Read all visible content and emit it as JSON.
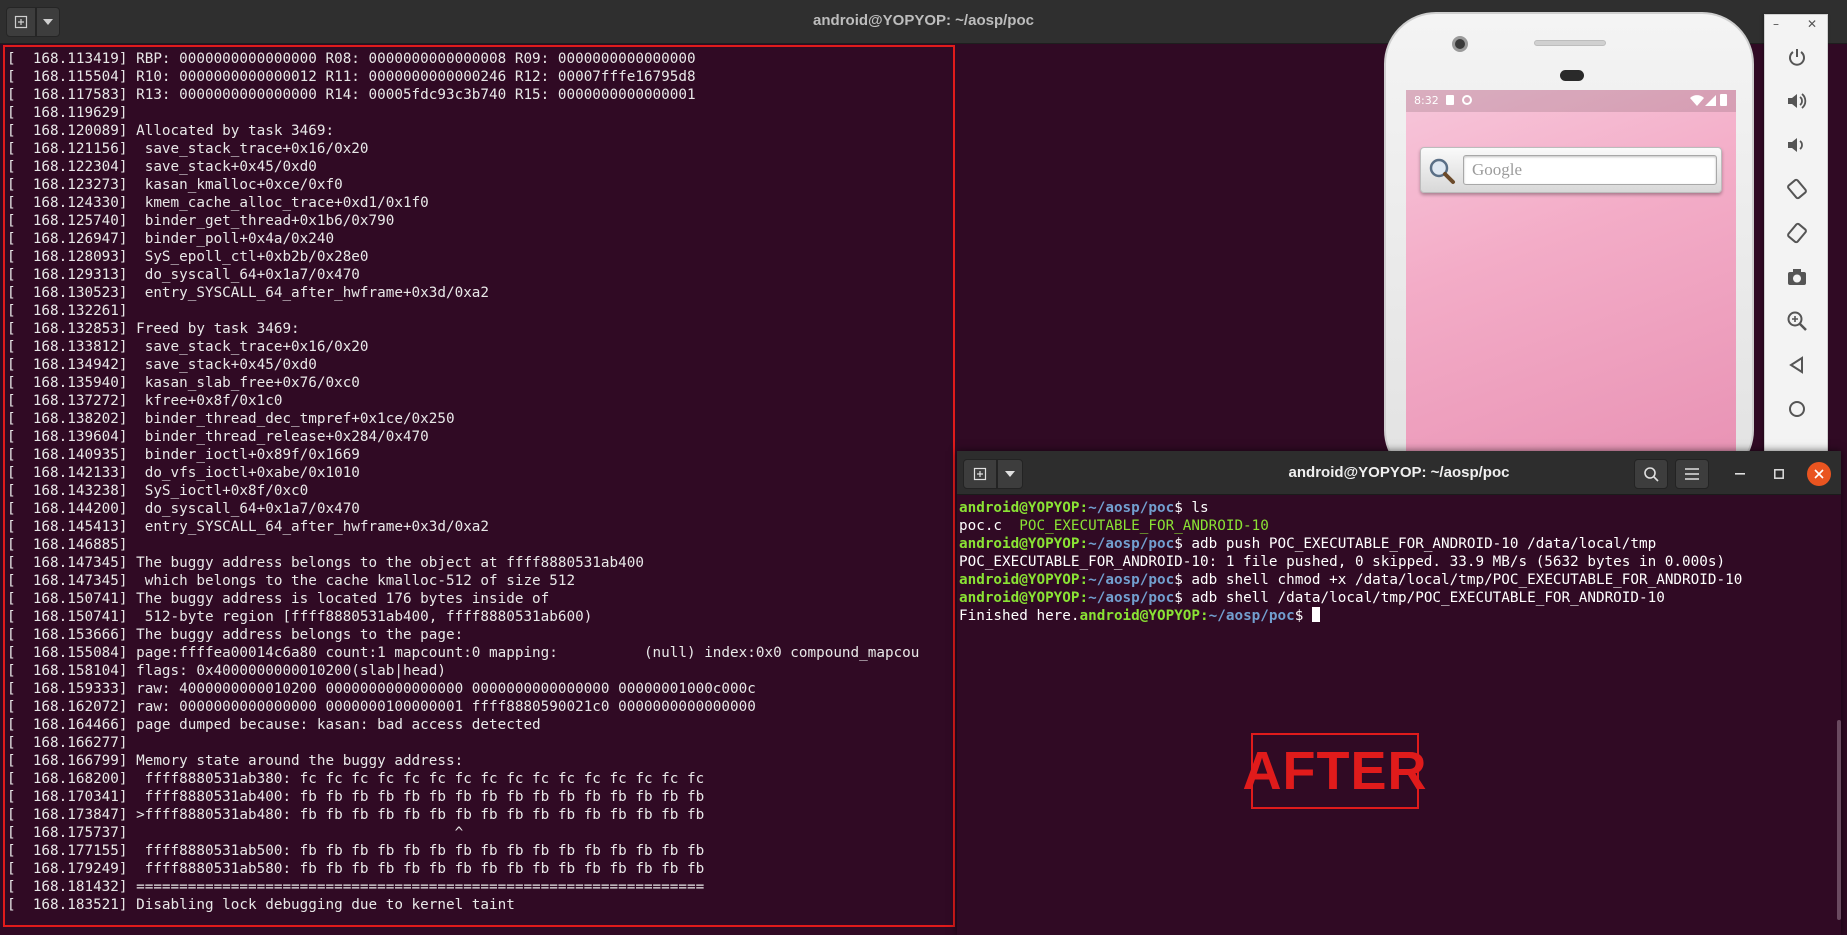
{
  "main_window": {
    "title": "android@YOPYOP: ~/aosp/poc",
    "new_tab_icon": "new-tab-icon",
    "log_lines": [
      "[  168.113419] RBP: 0000000000000000 R08: 0000000000000008 R09: 0000000000000000",
      "[  168.115504] R10: 0000000000000012 R11: 0000000000000246 R12: 00007fffe16795d8",
      "[  168.117583] R13: 0000000000000000 R14: 00005fdc93c3b740 R15: 0000000000000001",
      "[  168.119629]",
      "[  168.120089] Allocated by task 3469:",
      "[  168.121156]  save_stack_trace+0x16/0x20",
      "[  168.122304]  save_stack+0x45/0xd0",
      "[  168.123273]  kasan_kmalloc+0xce/0xf0",
      "[  168.124330]  kmem_cache_alloc_trace+0xd1/0x1f0",
      "[  168.125740]  binder_get_thread+0x1b6/0x790",
      "[  168.126947]  binder_poll+0x4a/0x240",
      "[  168.128093]  SyS_epoll_ctl+0xb2b/0x28e0",
      "[  168.129313]  do_syscall_64+0x1a7/0x470",
      "[  168.130523]  entry_SYSCALL_64_after_hwframe+0x3d/0xa2",
      "[  168.132261]",
      "[  168.132853] Freed by task 3469:",
      "[  168.133812]  save_stack_trace+0x16/0x20",
      "[  168.134942]  save_stack+0x45/0xd0",
      "[  168.135940]  kasan_slab_free+0x76/0xc0",
      "[  168.137272]  kfree+0x8f/0x1c0",
      "[  168.138202]  binder_thread_dec_tmpref+0x1ce/0x250",
      "[  168.139604]  binder_thread_release+0x284/0x470",
      "[  168.140935]  binder_ioctl+0x89f/0x1669",
      "[  168.142133]  do_vfs_ioctl+0xabe/0x1010",
      "[  168.143238]  SyS_ioctl+0x8f/0xc0",
      "[  168.144200]  do_syscall_64+0x1a7/0x470",
      "[  168.145413]  entry_SYSCALL_64_after_hwframe+0x3d/0xa2",
      "[  168.146885]",
      "[  168.147345] The buggy address belongs to the object at ffff8880531ab400",
      "[  168.147345]  which belongs to the cache kmalloc-512 of size 512",
      "[  168.150741] The buggy address is located 176 bytes inside of",
      "[  168.150741]  512-byte region [ffff8880531ab400, ffff8880531ab600)",
      "[  168.153666] The buggy address belongs to the page:",
      "[  168.155084] page:ffffea00014c6a80 count:1 mapcount:0 mapping:          (null) index:0x0 compound_mapcou",
      "[  168.158104] flags: 0x4000000000010200(slab|head)",
      "[  168.159333] raw: 4000000000010200 0000000000000000 0000000000000000 00000001000c000c",
      "[  168.162072] raw: 0000000000000000 0000000100000001 ffff8880590021c0 0000000000000000",
      "[  168.164466] page dumped because: kasan: bad access detected",
      "[  168.166277]",
      "[  168.166799] Memory state around the buggy address:",
      "[  168.168200]  ffff8880531ab380: fc fc fc fc fc fc fc fc fc fc fc fc fc fc fc fc",
      "[  168.170341]  ffff8880531ab400: fb fb fb fb fb fb fb fb fb fb fb fb fb fb fb fb",
      "[  168.173847] >ffff8880531ab480: fb fb fb fb fb fb fb fb fb fb fb fb fb fb fb fb",
      "[  168.175737]                                      ^",
      "[  168.177155]  ffff8880531ab500: fb fb fb fb fb fb fb fb fb fb fb fb fb fb fb fb",
      "[  168.179249]  ffff8880531ab580: fb fb fb fb fb fb fb fb fb fb fb fb fb fb fb fb",
      "[  168.181432] ==================================================================",
      "[  168.183521] Disabling lock debugging due to kernel taint"
    ]
  },
  "emulator": {
    "status_time": "8:32",
    "search_placeholder": "Google",
    "toolbar_icons": [
      "power-icon",
      "volume-up-icon",
      "volume-down-icon",
      "rotate-left-icon",
      "rotate-right-icon",
      "camera-icon",
      "zoom-icon",
      "back-icon",
      "home-icon"
    ]
  },
  "terminal2": {
    "title": "android@YOPYOP: ~/aosp/poc",
    "lines": [
      {
        "type": "cmd",
        "user": "android@YOPYOP",
        "path": "~/aosp/poc",
        "cmd": " ls"
      },
      {
        "type": "ls",
        "file1": "poc.c",
        "file2": "POC_EXECUTABLE_FOR_ANDROID-10"
      },
      {
        "type": "cmd",
        "user": "android@YOPYOP",
        "path": "~/aosp/poc",
        "cmd": " adb push POC_EXECUTABLE_FOR_ANDROID-10 /data/local/tmp"
      },
      {
        "type": "out",
        "text": "POC_EXECUTABLE_FOR_ANDROID-10: 1 file pushed, 0 skipped. 33.9 MB/s (5632 bytes in 0.000s)"
      },
      {
        "type": "cmd",
        "user": "android@YOPYOP",
        "path": "~/aosp/poc",
        "cmd": " adb shell chmod +x /data/local/tmp/POC_EXECUTABLE_FOR_ANDROID-10"
      },
      {
        "type": "cmd",
        "user": "android@YOPYOP",
        "path": "~/aosp/poc",
        "cmd": " adb shell /data/local/tmp/POC_EXECUTABLE_FOR_ANDROID-10"
      },
      {
        "type": "final",
        "prefix": "Finished here.",
        "user": "android@YOPYOP",
        "path": "~/aosp/poc",
        "cmd": " "
      }
    ]
  },
  "overlay": {
    "after_label": "AFTER"
  },
  "colors": {
    "terminal_bg": "#300a24",
    "highlight": "#e01b1b",
    "prompt_user": "#8ae234",
    "prompt_path": "#729fcf"
  }
}
